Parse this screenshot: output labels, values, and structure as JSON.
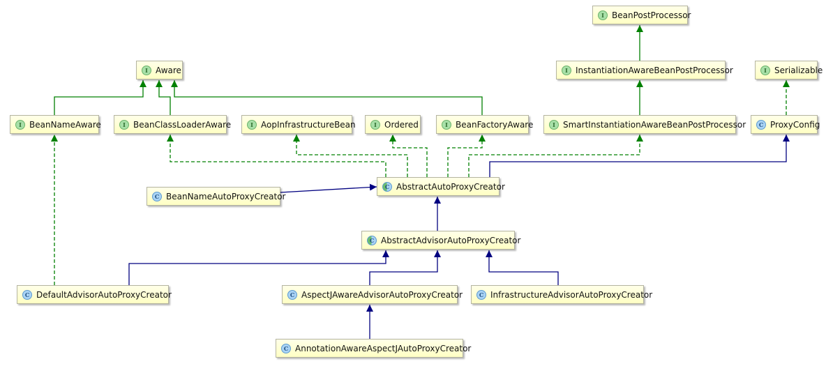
{
  "colors": {
    "interface_edge": "#008000",
    "class_edge": "#000080"
  },
  "nodes": [
    {
      "id": "BeanPostProcessor",
      "label": "BeanPostProcessor",
      "kind": "interface"
    },
    {
      "id": "Aware",
      "label": "Aware",
      "kind": "interface"
    },
    {
      "id": "InstantiationAwareBeanPostProcessor",
      "label": "InstantiationAwareBeanPostProcessor",
      "kind": "interface"
    },
    {
      "id": "Serializable",
      "label": "Serializable",
      "kind": "interface"
    },
    {
      "id": "BeanNameAware",
      "label": "BeanNameAware",
      "kind": "interface"
    },
    {
      "id": "BeanClassLoaderAware",
      "label": "BeanClassLoaderAware",
      "kind": "interface"
    },
    {
      "id": "AopInfrastructureBean",
      "label": "AopInfrastructureBean",
      "kind": "interface"
    },
    {
      "id": "Ordered",
      "label": "Ordered",
      "kind": "interface"
    },
    {
      "id": "BeanFactoryAware",
      "label": "BeanFactoryAware",
      "kind": "interface"
    },
    {
      "id": "SmartInstantiationAwareBeanPostProcessor",
      "label": "SmartInstantiationAwareBeanPostProcessor",
      "kind": "interface"
    },
    {
      "id": "ProxyConfig",
      "label": "ProxyConfig",
      "kind": "class"
    },
    {
      "id": "BeanNameAutoProxyCreator",
      "label": "BeanNameAutoProxyCreator",
      "kind": "class"
    },
    {
      "id": "AbstractAutoProxyCreator",
      "label": "AbstractAutoProxyCreator",
      "kind": "abstract"
    },
    {
      "id": "AbstractAdvisorAutoProxyCreator",
      "label": "AbstractAdvisorAutoProxyCreator",
      "kind": "abstract"
    },
    {
      "id": "DefaultAdvisorAutoProxyCreator",
      "label": "DefaultAdvisorAutoProxyCreator",
      "kind": "class"
    },
    {
      "id": "AspectJAwareAdvisorAutoProxyCreator",
      "label": "AspectJAwareAdvisorAutoProxyCreator",
      "kind": "class"
    },
    {
      "id": "InfrastructureAdvisorAutoProxyCreator",
      "label": "InfrastructureAdvisorAutoProxyCreator",
      "kind": "class"
    },
    {
      "id": "AnnotationAwareAspectJAutoProxyCreator",
      "label": "AnnotationAwareAspectJAutoProxyCreator",
      "kind": "class"
    }
  ],
  "icon_letters": {
    "interface": "I",
    "class": "C",
    "abstract": "C"
  },
  "edges": [
    {
      "from": "InstantiationAwareBeanPostProcessor",
      "to": "BeanPostProcessor",
      "type": "extends-interface"
    },
    {
      "from": "SmartInstantiationAwareBeanPostProcessor",
      "to": "InstantiationAwareBeanPostProcessor",
      "type": "extends-interface"
    },
    {
      "from": "BeanNameAware",
      "to": "Aware",
      "type": "extends-interface"
    },
    {
      "from": "BeanClassLoaderAware",
      "to": "Aware",
      "type": "extends-interface"
    },
    {
      "from": "BeanFactoryAware",
      "to": "Aware",
      "type": "extends-interface"
    },
    {
      "from": "ProxyConfig",
      "to": "Serializable",
      "type": "implements"
    },
    {
      "from": "DefaultAdvisorAutoProxyCreator",
      "to": "BeanNameAware",
      "type": "implements"
    },
    {
      "from": "AbstractAutoProxyCreator",
      "to": "BeanClassLoaderAware",
      "type": "implements"
    },
    {
      "from": "AbstractAutoProxyCreator",
      "to": "AopInfrastructureBean",
      "type": "implements"
    },
    {
      "from": "AbstractAutoProxyCreator",
      "to": "Ordered",
      "type": "implements"
    },
    {
      "from": "AbstractAutoProxyCreator",
      "to": "BeanFactoryAware",
      "type": "implements"
    },
    {
      "from": "AbstractAutoProxyCreator",
      "to": "SmartInstantiationAwareBeanPostProcessor",
      "type": "implements"
    },
    {
      "from": "AbstractAutoProxyCreator",
      "to": "ProxyConfig",
      "type": "extends"
    },
    {
      "from": "BeanNameAutoProxyCreator",
      "to": "AbstractAutoProxyCreator",
      "type": "extends"
    },
    {
      "from": "AbstractAdvisorAutoProxyCreator",
      "to": "AbstractAutoProxyCreator",
      "type": "extends"
    },
    {
      "from": "DefaultAdvisorAutoProxyCreator",
      "to": "AbstractAdvisorAutoProxyCreator",
      "type": "extends"
    },
    {
      "from": "AspectJAwareAdvisorAutoProxyCreator",
      "to": "AbstractAdvisorAutoProxyCreator",
      "type": "extends"
    },
    {
      "from": "InfrastructureAdvisorAutoProxyCreator",
      "to": "AbstractAdvisorAutoProxyCreator",
      "type": "extends"
    },
    {
      "from": "AnnotationAwareAspectJAutoProxyCreator",
      "to": "AspectJAwareAdvisorAutoProxyCreator",
      "type": "extends"
    }
  ]
}
